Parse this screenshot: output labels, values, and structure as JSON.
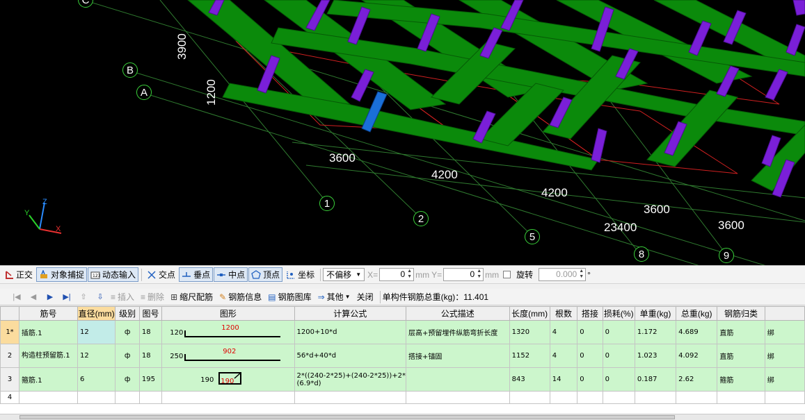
{
  "viewport": {
    "grid_axes": [
      "C",
      "B",
      "A",
      "1",
      "2",
      "5",
      "8",
      "9"
    ],
    "dimensions": [
      "3900",
      "1200",
      "3600",
      "4200",
      "4200",
      "3600",
      "23400",
      "3600"
    ],
    "ucs_labels": {
      "x": "X",
      "y": "Y",
      "z": "Z"
    }
  },
  "toolbar1": {
    "ortho": "正交",
    "snap": "对象捕捉",
    "dynamic_input": "动态输入",
    "intersection": "交点",
    "perpendicular": "垂点",
    "midpoint": "中点",
    "vertex": "顶点",
    "coordinate": "坐标",
    "offset_mode": "不偏移",
    "x_label": "X=",
    "x_value": "0",
    "mm1": "mm",
    "y_label": "Y=",
    "y_value": "0",
    "mm2": "mm",
    "rotate_label": "旋转",
    "rotate_value": "0.000",
    "degree": "°"
  },
  "toolbar2": {
    "insert": "插入",
    "delete": "删除",
    "scale_rebar": "缩尺配筋",
    "rebar_info": "钢筋信息",
    "rebar_library": "钢筋图库",
    "other": "其他",
    "close": "关闭",
    "total_weight": "单构件钢筋总重(kg)：11.401"
  },
  "table": {
    "headers": [
      "",
      "筋号",
      "直径(mm)",
      "级别",
      "图号",
      "图形",
      "计算公式",
      "公式描述",
      "长度(mm)",
      "根数",
      "搭接",
      "损耗(%)",
      "单重(kg)",
      "总重(kg)",
      "钢筋归类",
      ""
    ],
    "rows": [
      {
        "no": "1*",
        "name": "插筋.1",
        "diameter": "12",
        "grade": "ф",
        "fig": "18",
        "shape_left": "120",
        "shape_main": "1200",
        "formula": "1200+10*d",
        "desc": "层高+预留埋件纵筋弯折长度",
        "length": "1320",
        "count": "4",
        "lap": "0",
        "loss": "0",
        "unit_wt": "1.172",
        "total_wt": "4.689",
        "category": "直筋",
        "extra": "绑"
      },
      {
        "no": "2",
        "name": "构造柱预留筋.1",
        "diameter": "12",
        "grade": "ф",
        "fig": "18",
        "shape_left": "250",
        "shape_main": "902",
        "formula": "56*d+40*d",
        "desc": "搭接+锚固",
        "length": "1152",
        "count": "4",
        "lap": "0",
        "loss": "0",
        "unit_wt": "1.023",
        "total_wt": "4.092",
        "category": "直筋",
        "extra": "绑"
      },
      {
        "no": "3",
        "name": "箍筋.1",
        "diameter": "6",
        "grade": "ф",
        "fig": "195",
        "shape_left": "190",
        "shape_main": "190",
        "formula": "2*((240-2*25)+(240-2*25))+2*(6.9*d)",
        "desc": "",
        "length": "843",
        "count": "14",
        "lap": "0",
        "loss": "0",
        "unit_wt": "0.187",
        "total_wt": "2.62",
        "category": "箍筋",
        "extra": "绑"
      },
      {
        "no": "4"
      }
    ]
  }
}
